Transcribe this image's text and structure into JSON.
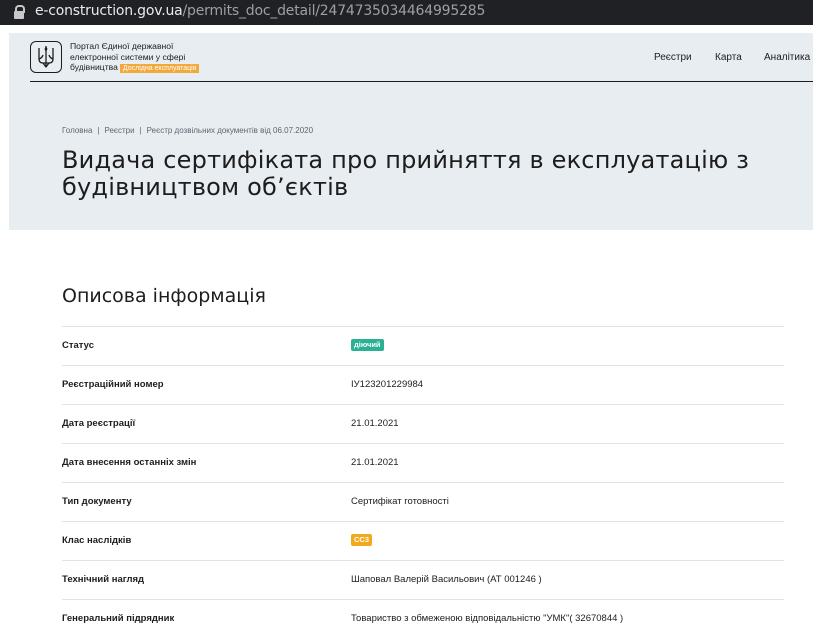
{
  "browser": {
    "url_host": "e-construction.gov.ua",
    "url_path": "/permits_doc_detail/2474735034464995285"
  },
  "header": {
    "portal_name_line1": "Портал Єдиної державної",
    "portal_name_line2": "електронної системи у сфері",
    "portal_name_line3": "будівництва",
    "badge": "Дослідна експлуатація",
    "badge_color": "#f2a93b",
    "logo_icon": "trident-icon",
    "nav": [
      "Реєстри",
      "Карта",
      "Аналітика"
    ]
  },
  "breadcrumb": [
    "Головна",
    "Реєстри",
    "Реєстр дозвільних документів від 06.07.2020"
  ],
  "page": {
    "title_line1": "Видача сертифіката про прийняття в експлуатацію з",
    "title_line2": "будівництвом об’єктів"
  },
  "info": {
    "section_title": "Описова інформація",
    "rows": [
      {
        "label": "Статус",
        "value": "діючий",
        "pill_color": "#2ab093"
      },
      {
        "label": "Реєстраційний номер",
        "value": "ІУ123201229984"
      },
      {
        "label": "Дата реєстрації",
        "value": "21.01.2021"
      },
      {
        "label": "Дата внесення останніх змін",
        "value": "21.01.2021"
      },
      {
        "label": "Тип документу",
        "value": "Сертифікат готовності"
      },
      {
        "label": "Клас наслідків",
        "value": "СС3",
        "pill_color": "#f2a91d"
      },
      {
        "label": "Технічний нагляд",
        "value": "Шаповал Валерій Васильович (АТ 001246 )"
      },
      {
        "label": "Генеральний підрядник",
        "value": "Товариство з обмеженою відповідальністю \"УМК\"( 32670844 )"
      }
    ]
  }
}
